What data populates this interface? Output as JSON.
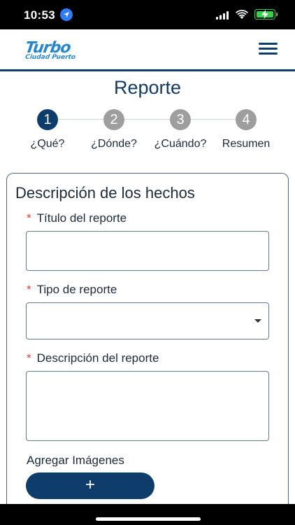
{
  "status_bar": {
    "time": "10:53",
    "icons": [
      "location-icon",
      "signal-icon",
      "wifi-icon",
      "battery-charging-icon"
    ],
    "battery_color": "#37d04a"
  },
  "header": {
    "logo_main": "Turbo",
    "logo_sub": "Ciudad Puerto",
    "menu_icon": "hamburger-menu-icon",
    "brand_color": "#0f3d6b",
    "logo_color": "#2a86c9"
  },
  "page": {
    "title": "Reporte"
  },
  "steps": [
    {
      "number": "1",
      "label": "¿Qué?",
      "active": true
    },
    {
      "number": "2",
      "label": "¿Dónde?",
      "active": false
    },
    {
      "number": "3",
      "label": "¿Cuándo?",
      "active": false
    },
    {
      "number": "4",
      "label": "Resumen",
      "active": false
    }
  ],
  "form": {
    "section_title": "Descripción de los hechos",
    "required_marker": "*",
    "fields": {
      "title": {
        "label": "Título del reporte",
        "value": ""
      },
      "type": {
        "label": "Tipo de reporte",
        "value": ""
      },
      "description": {
        "label": "Descripción del reporte",
        "value": ""
      }
    },
    "images_label": "Agregar Imágenes",
    "add_button_label": "+"
  }
}
